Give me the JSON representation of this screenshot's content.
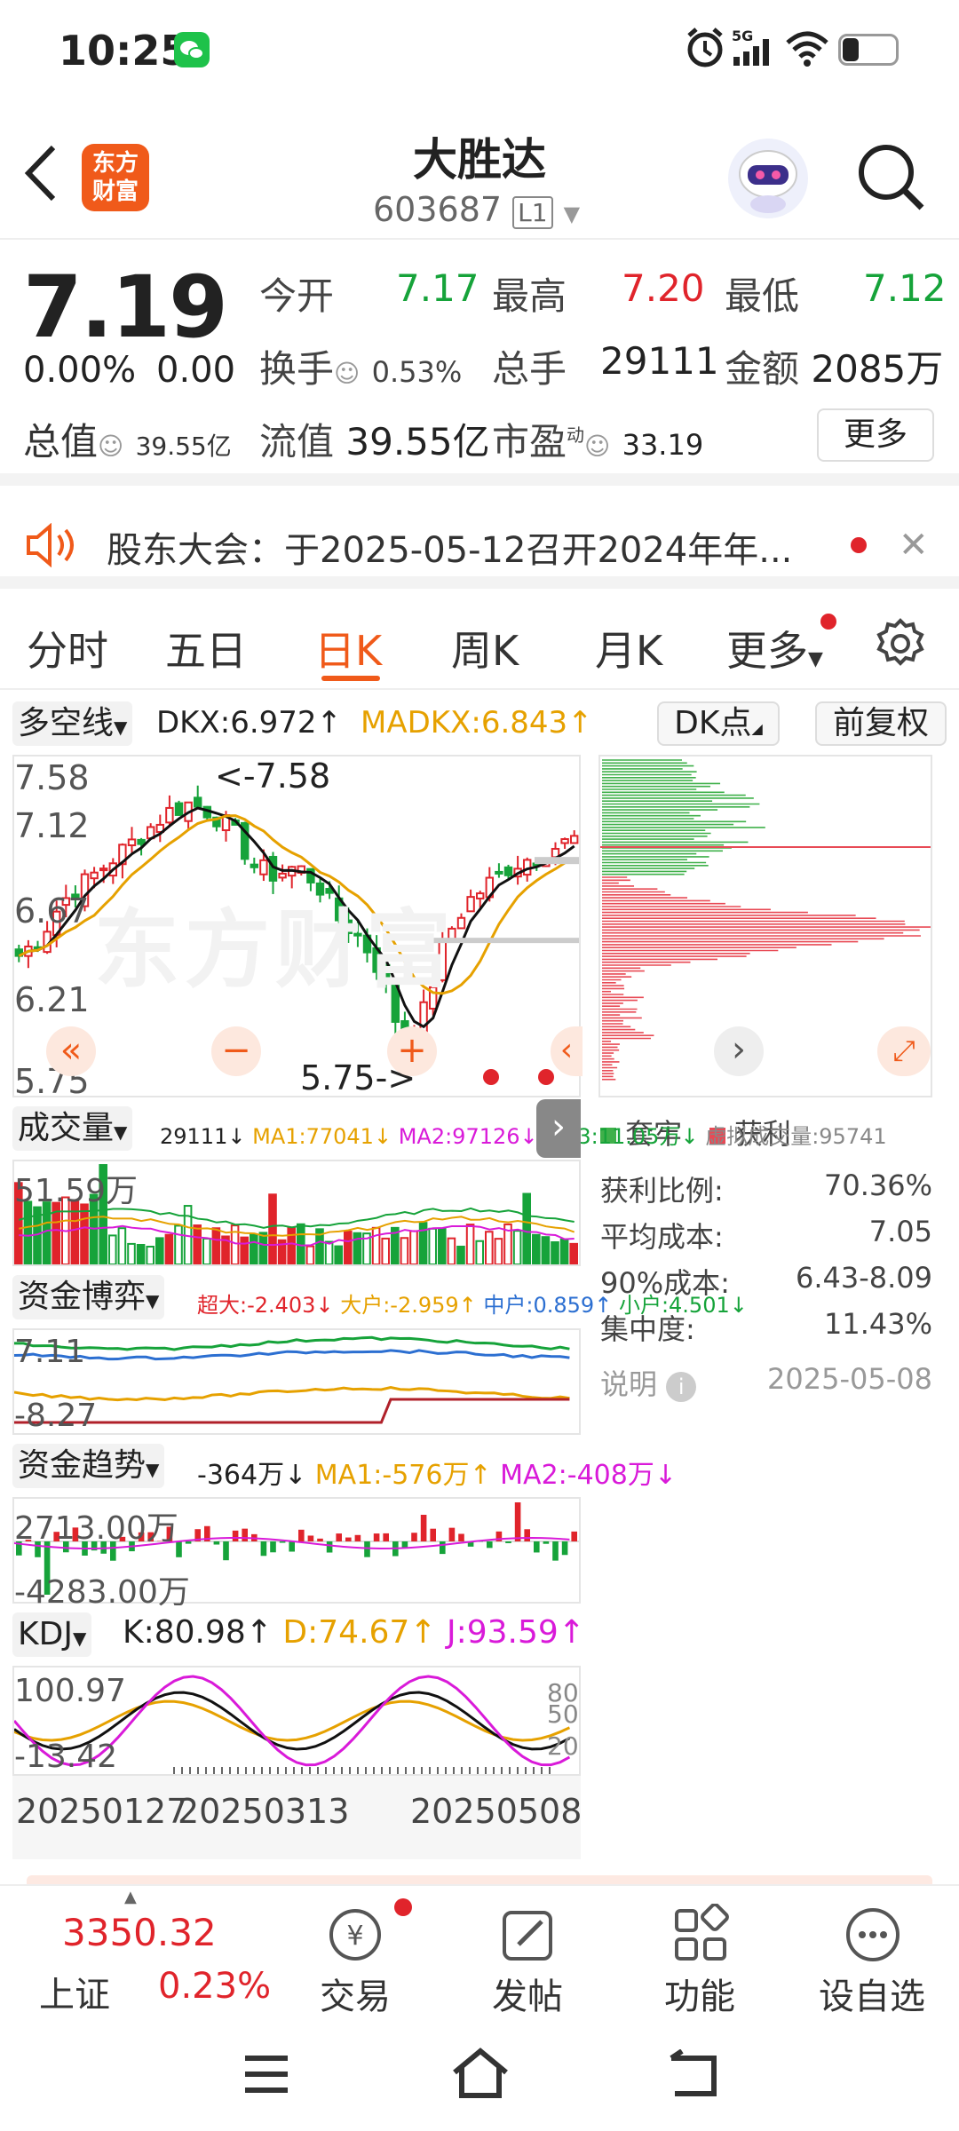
{
  "status_bar": {
    "time": "10:25",
    "network": "5G"
  },
  "header": {
    "title": "大胜达",
    "code": "603687",
    "level": "L1",
    "logo_text_1": "东方",
    "logo_text_2": "财富"
  },
  "quote": {
    "price": "7.19",
    "change_pct": "0.00%",
    "change": "0.00",
    "open_label": "今开",
    "open": "7.17",
    "high_label": "最高",
    "high": "7.20",
    "low_label": "最低",
    "low": "7.12",
    "turnover_label": "换手",
    "turnover": "0.53%",
    "volume_label": "总手",
    "volume": "29111",
    "amount_label": "金额",
    "amount": "2085万",
    "mktcap_label": "总值",
    "mktcap": "39.55亿",
    "float_label": "流值",
    "float_cap": "39.55亿",
    "pe_label": "市盈",
    "pe_sup": "动",
    "pe": "33.19",
    "more_button": "更多"
  },
  "notice": {
    "text": "股东大会：于2025-05-12召开2024年年..."
  },
  "tabs": [
    "分时",
    "五日",
    "日K",
    "周K",
    "月K",
    "更多"
  ],
  "active_tab": 2,
  "kline": {
    "indicator_select": "多空线",
    "dkx": "DKX:6.972↑",
    "madkx": "MADKX:6.843↑",
    "dk_button": "DK点",
    "adjust_button": "前复权",
    "y_labels": [
      "7.58",
      "7.12",
      "6.67",
      "6.21",
      "5.75"
    ],
    "max_marker": "<-7.58",
    "min_marker": "5.75->",
    "watermark": "东方财富"
  },
  "chip": {
    "legend_trapped": "套牢",
    "legend_profit": "获利",
    "rows": [
      {
        "label": "获利比例:",
        "value": "70.36%"
      },
      {
        "label": "平均成本:",
        "value": "7.05"
      },
      {
        "label": "90%成本:",
        "value": "6.43-8.09"
      },
      {
        "label": "集中度:",
        "value": "11.43%"
      }
    ],
    "note_label": "说明",
    "date": "2025-05-08"
  },
  "volume_panel": {
    "select": "成交量",
    "v": "29111↓",
    "ma1": "MA1:77041↓",
    "ma2": "MA2:97126↓",
    "ma3": "MA3:11.05万↓",
    "virtual": "虚拟成交量:95741",
    "y_label": "51.59万"
  },
  "fund_game": {
    "select": "资金博弈",
    "super": "超大:-2.403↓",
    "big": "大户:-2.959↑",
    "mid": "中户:0.859↑",
    "small": "小户:4.501↓",
    "y_top": "7.11",
    "y_bottom": "-8.27"
  },
  "fund_trend": {
    "select": "资金趋势",
    "val": "-364万↓",
    "ma1": "MA1:-576万↑",
    "ma2": "MA2:-408万↓",
    "y_top": "2713.00万",
    "y_bottom": "-4283.00万"
  },
  "kdj": {
    "select": "KDJ",
    "k": "K:80.98↑",
    "d": "D:74.67↑",
    "j": "J:93.59↑",
    "y_top": "100.97",
    "y_bottom": "-13.42",
    "l80": "80",
    "l50": "50",
    "l20": "20"
  },
  "x_dates": [
    "20250127",
    "20250313",
    "20250508"
  ],
  "bottom_index": {
    "value": "3350.32",
    "name": "上证",
    "pct": "0.23%"
  },
  "bottom_nav": [
    "交易",
    "发帖",
    "功能",
    "设自选"
  ],
  "colors": {
    "up": "#e0242b",
    "down": "#16a33a",
    "accent": "#f05a1a",
    "gold": "#e6a100",
    "magenta": "#d91ad9"
  }
}
